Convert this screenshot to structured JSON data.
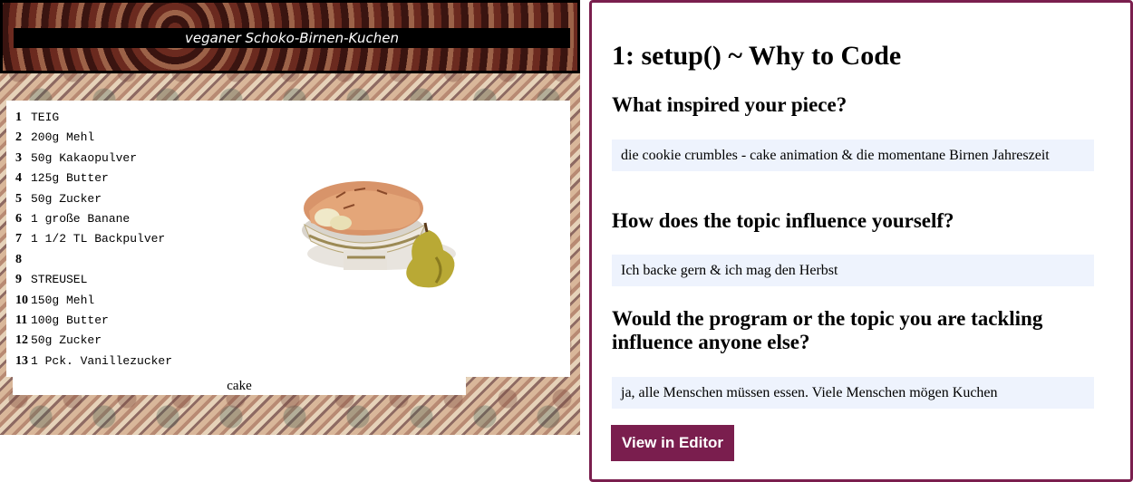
{
  "sketch": {
    "banner_title": "veganer Schoko-Birnen-Kuchen",
    "recipe_lines": [
      {
        "num": "1",
        "text": "TEIG"
      },
      {
        "num": "2",
        "text": "200g Mehl"
      },
      {
        "num": "3",
        "text": "50g Kakaopulver"
      },
      {
        "num": "4",
        "text": "125g Butter"
      },
      {
        "num": "5",
        "text": "50g Zucker"
      },
      {
        "num": "6",
        "text": "1 große Banane"
      },
      {
        "num": "7",
        "text": "1 1/2 TL Backpulver"
      },
      {
        "num": "8",
        "text": ""
      },
      {
        "num": "9",
        "text": "STREUSEL"
      },
      {
        "num": "10",
        "text": "150g Mehl"
      },
      {
        "num": "11",
        "text": "100g Butter"
      },
      {
        "num": "12",
        "text": "50g Zucker"
      },
      {
        "num": "13",
        "text": "1 Pck. Vanillezucker"
      }
    ],
    "caption": "cake"
  },
  "panel": {
    "title": "1: setup() ~ Why to Code",
    "q1": "What inspired your piece?",
    "a1": "die cookie crumbles - cake animation & die momentane Birnen Jahreszeit",
    "q2": "How does the topic influence yourself?",
    "a2": "Ich backe gern & ich mag den Herbst",
    "q3": "Would the program or the topic you are tackling influence anyone else?",
    "a3": "ja, alle Menschen müssen essen. Viele Menschen mögen Kuchen",
    "button_label": "View in Editor"
  },
  "colors": {
    "accent": "#7a1e4e",
    "answer_bg": "#eef3fd"
  }
}
